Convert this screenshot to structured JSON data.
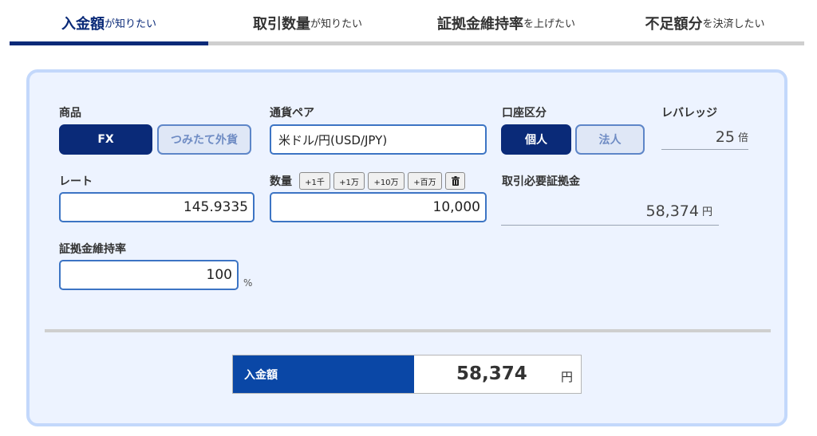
{
  "tabs": [
    {
      "strong": "入金額",
      "weak": "が知りたい",
      "active": true
    },
    {
      "strong": "取引数量",
      "weak": "が知りたい",
      "active": false
    },
    {
      "strong": "証拠金維持率",
      "weak": "を上げたい",
      "active": false
    },
    {
      "strong": "不足額分",
      "weak": "を決済したい",
      "active": false
    }
  ],
  "product": {
    "label": "商品",
    "options": [
      "FX",
      "つみたて外貨"
    ],
    "selected": "FX"
  },
  "currency_pair": {
    "label": "通貨ペア",
    "value": "米ドル/円(USD/JPY)"
  },
  "account_type": {
    "label": "口座区分",
    "options": [
      "個人",
      "法人"
    ],
    "selected": "個人"
  },
  "leverage": {
    "label": "レバレッジ",
    "value": "25",
    "unit": "倍"
  },
  "rate": {
    "label": "レート",
    "value": "145.9335"
  },
  "quantity": {
    "label": "数量",
    "value": "10,000",
    "buttons": [
      "+1千",
      "+1万",
      "+10万",
      "+百万"
    ],
    "trash_icon": "trash-icon"
  },
  "required_margin": {
    "label": "取引必要証拠金",
    "value": "58,374",
    "unit": "円"
  },
  "margin_ratio": {
    "label": "証拠金維持率",
    "value": "100",
    "unit": "%"
  },
  "result": {
    "label": "入金額",
    "value": "58,374",
    "unit": "円"
  },
  "colors": {
    "accent": "#0a2a78",
    "result_header": "#0a47a6",
    "panel_bg": "#edf3ff",
    "panel_border": "#c3d8fb",
    "field_border": "#3c74c4"
  }
}
